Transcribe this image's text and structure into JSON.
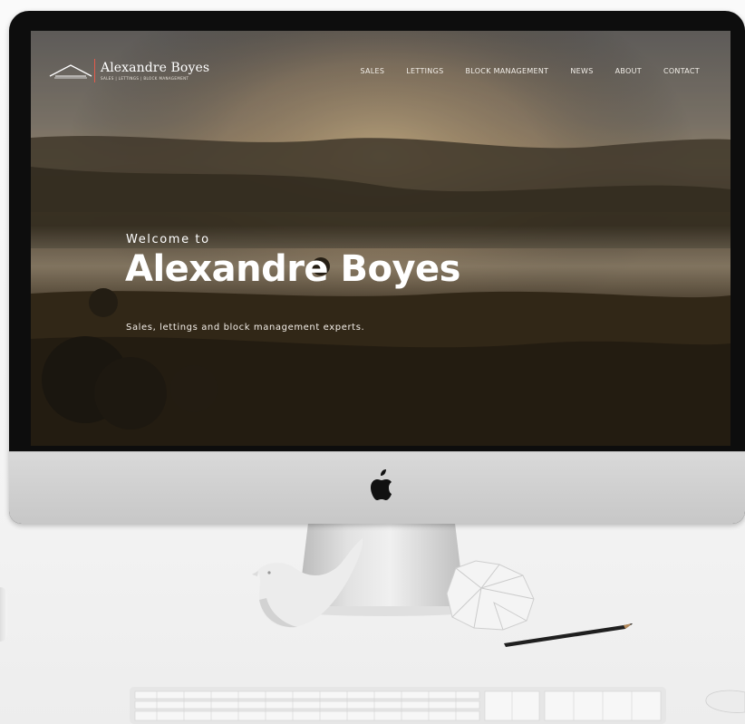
{
  "site": {
    "brand": "Alexandre Boyes",
    "brand_tagline": "SALES | LETTINGS | BLOCK MANAGEMENT",
    "nav": [
      "SALES",
      "LETTINGS",
      "BLOCK MANAGEMENT",
      "NEWS",
      "ABOUT",
      "CONTACT"
    ],
    "hero": {
      "welcome": "Welcome to",
      "title": "Alexandre Boyes",
      "subtitle": "Sales, lettings and block management experts."
    }
  },
  "colors": {
    "accent": "#e45b4b",
    "text": "#ffffff"
  },
  "icons": {
    "apple_logo": "apple-icon",
    "brand_logo": "house-roof-icon"
  }
}
